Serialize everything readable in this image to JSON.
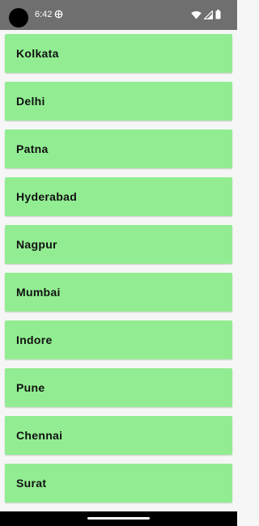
{
  "status_bar": {
    "time": "6:42",
    "icons": [
      "vpn-icon",
      "wifi-icon",
      "cellular-signal-icon",
      "battery-icon"
    ]
  },
  "colors": {
    "status_bar_bg": "#6f6f6f",
    "item_bg": "#92ed92",
    "page_bg": "#f6f6f6"
  },
  "cities": [
    {
      "label": "Kolkata"
    },
    {
      "label": "Delhi"
    },
    {
      "label": "Patna"
    },
    {
      "label": "Hyderabad"
    },
    {
      "label": "Nagpur"
    },
    {
      "label": "Mumbai"
    },
    {
      "label": "Indore"
    },
    {
      "label": "Pune"
    },
    {
      "label": "Chennai"
    },
    {
      "label": "Surat"
    }
  ]
}
